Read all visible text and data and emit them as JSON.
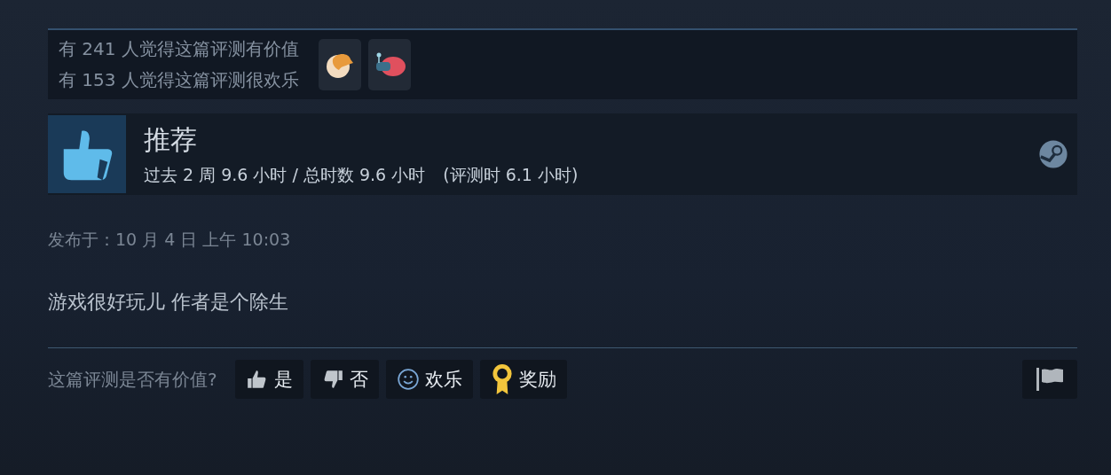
{
  "reactions": {
    "lines": [
      "有 241 人觉得这篇评测有价值",
      "有 153 人觉得这篇评测很欢乐"
    ]
  },
  "review": {
    "verdict": "推荐",
    "playtime": "过去 2 周 9.6 小时 / 总时数 9.6 小时",
    "playtime_at_review": "(评测时 6.1 小时)"
  },
  "posted": "发布于：10 月 4 日 上午 10:03",
  "body": "游戏很好玩儿 作者是个除生",
  "vote": {
    "prompt": "这篇评测是否有价值?",
    "buttons": [
      {
        "kind": "yes",
        "label": "是"
      },
      {
        "kind": "no",
        "label": "否"
      },
      {
        "kind": "funny",
        "label": "欢乐"
      },
      {
        "kind": "award",
        "label": "奖励"
      }
    ]
  }
}
